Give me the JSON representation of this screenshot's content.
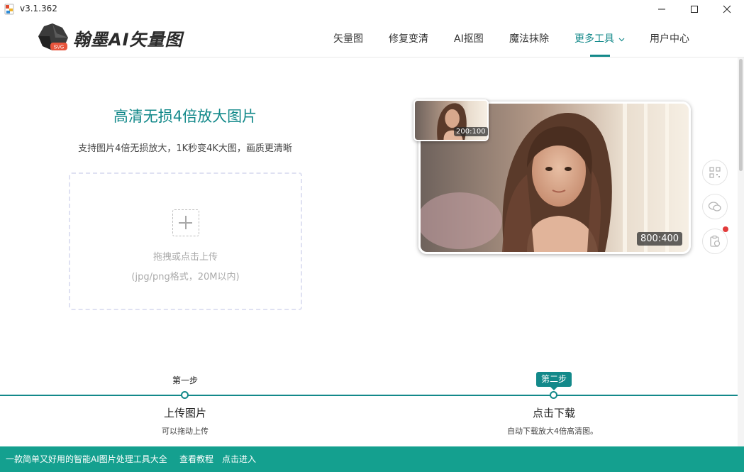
{
  "window": {
    "version": "v3.1.362"
  },
  "header": {
    "brand": "翰墨AI矢量图",
    "logo_badge": "SVG",
    "nav": [
      {
        "label": "矢量图"
      },
      {
        "label": "修复变清"
      },
      {
        "label": "AI抠图"
      },
      {
        "label": "魔法抹除"
      },
      {
        "label": "更多工具"
      },
      {
        "label": "用户中心"
      }
    ],
    "active_nav": "更多工具"
  },
  "hero": {
    "title": "高清无损4倍放大图片",
    "subtitle": "支持图片4倍无损放大，1K秒变4K大图，画质更清晰"
  },
  "upload": {
    "hint": "拖拽或点击上传",
    "format": "(jpg/png格式，20M以内)"
  },
  "preview": {
    "small_size": "200:100",
    "big_size": "800:400"
  },
  "steps": [
    {
      "badge": "第一步",
      "title": "上传图片",
      "desc": "可以拖动上传"
    },
    {
      "badge": "第二步",
      "title": "点击下载",
      "desc": "自动下载放大4倍高清图。"
    }
  ],
  "footer": {
    "slogan": "一款简单又好用的智能AI图片处理工具大全",
    "tutorial": "查看教程",
    "enter": "点击进入"
  },
  "colors": {
    "accent": "#13898a",
    "footer": "#14a08f",
    "notification": "#e23b3b"
  }
}
